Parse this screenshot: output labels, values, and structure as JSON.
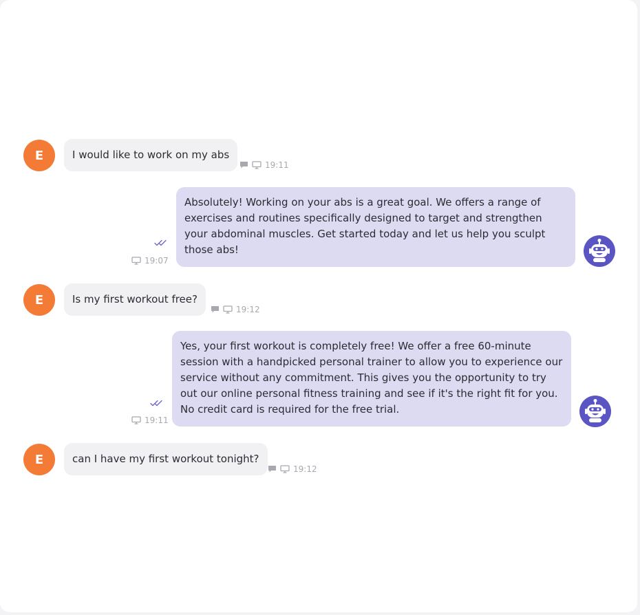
{
  "colors": {
    "user_avatar": "#f47b36",
    "bot_avatar": "#5b55c4",
    "user_bubble": "#f1f1f4",
    "bot_bubble": "#dcdbf2",
    "tick": "#6a63c9"
  },
  "messages": [
    {
      "sender": "user",
      "initial": "E",
      "text": "I would like to work on my abs",
      "time": "19:11",
      "icons": [
        "chat-icon",
        "monitor-icon"
      ]
    },
    {
      "sender": "bot",
      "text": "Absolutely! Working on your abs is a great goal. We offers a range of exercises and routines specifically designed to target and strengthen your abdominal muscles. Get started today and let us help you sculpt those abs!",
      "time": "19:07",
      "icons": [
        "double-check-icon",
        "monitor-icon"
      ]
    },
    {
      "sender": "user",
      "initial": "E",
      "text": "Is my first workout free?",
      "time": "19:12",
      "icons": [
        "chat-icon",
        "monitor-icon"
      ]
    },
    {
      "sender": "bot",
      "text": "Yes, your first workout is completely free! We offer a free 60-minute session with a handpicked personal trainer to allow you to experience our service without any commitment. This gives you the opportunity to try out our online personal fitness training and see if it's the right fit for you. No credit card is required for the free trial.",
      "time": "19:11",
      "icons": [
        "double-check-icon",
        "monitor-icon"
      ]
    },
    {
      "sender": "user",
      "initial": "E",
      "text": "can I have my first workout tonight?",
      "time": "19:12",
      "icons": [
        "chat-icon",
        "monitor-icon"
      ]
    }
  ]
}
